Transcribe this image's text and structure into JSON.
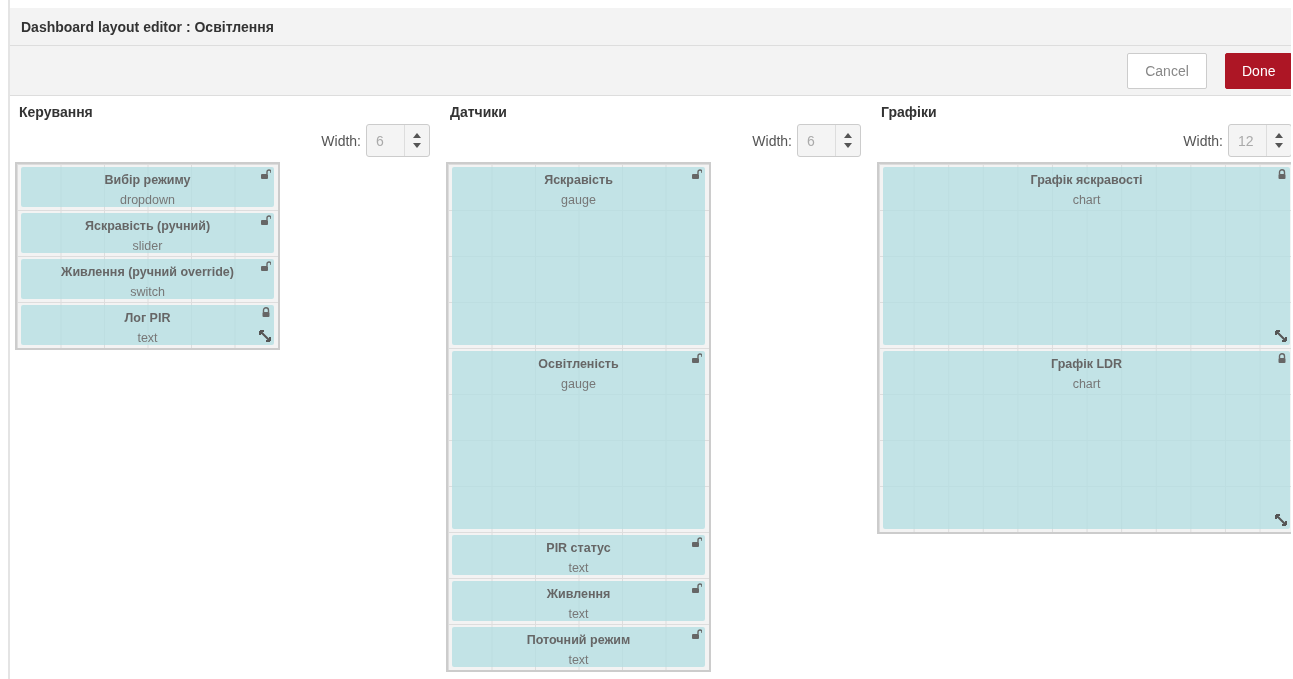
{
  "window": {
    "title": "Dashboard layout editor : Освітлення"
  },
  "toolbar": {
    "buttons": [
      {
        "label": "Cancel",
        "kind": "secondary"
      },
      {
        "label": "Done",
        "kind": "primary"
      }
    ]
  },
  "groups": [
    {
      "title": "Керування",
      "width_label": "Width:",
      "width_value": "6",
      "kind": "half",
      "widgets": [
        {
          "name": "Вибір режиму",
          "type": "dropdown",
          "kind": "single",
          "locked": false
        },
        {
          "name": "Яскравість (ручний)",
          "type": "slider",
          "kind": "single",
          "locked": false
        },
        {
          "name": "Живлення (ручний override)",
          "type": "switch",
          "kind": "single",
          "locked": false
        },
        {
          "name": "Лог PIR",
          "type": "text",
          "kind": "single",
          "locked": true
        }
      ]
    },
    {
      "title": "Датчики",
      "width_label": "Width:",
      "width_value": "6",
      "kind": "half",
      "widgets": [
        {
          "name": "Яскравість",
          "type": "gauge",
          "kind": "tall",
          "locked": false
        },
        {
          "name": "Освітленість",
          "type": "gauge",
          "kind": "tall",
          "locked": false
        },
        {
          "name": "PIR статус",
          "type": "text",
          "kind": "single",
          "locked": false
        },
        {
          "name": "Живлення",
          "type": "text",
          "kind": "single",
          "locked": false
        },
        {
          "name": "Поточний режим",
          "type": "text",
          "kind": "single",
          "locked": false
        }
      ]
    },
    {
      "title": "Графіки",
      "width_label": "Width:",
      "width_value": "12",
      "kind": "full",
      "widgets": [
        {
          "name": "Графік яскравості",
          "type": "chart",
          "kind": "tall",
          "locked": true
        },
        {
          "name": "Графік LDR",
          "type": "chart",
          "kind": "tall",
          "locked": true
        }
      ]
    }
  ]
}
